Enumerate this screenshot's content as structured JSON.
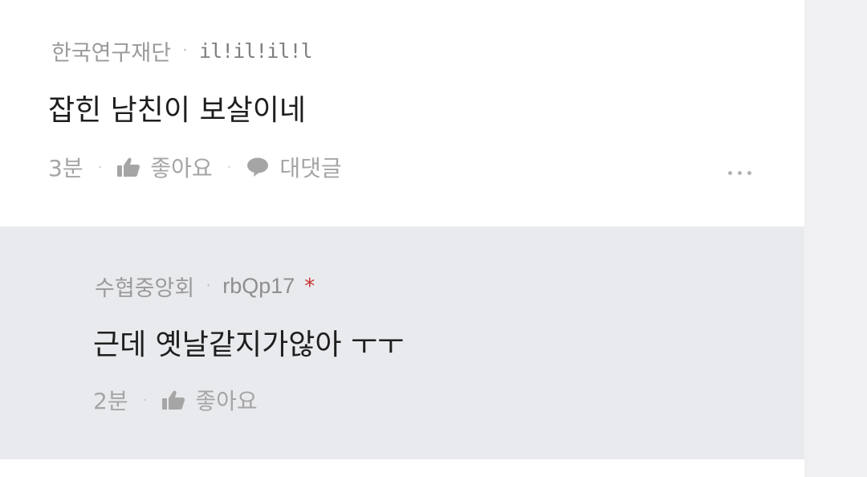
{
  "comments": [
    {
      "affiliation": "한국연구재단",
      "username": "il!il!il!l",
      "text": "잡힌 남친이 보살이네",
      "time": "3분",
      "like_label": "좋아요",
      "reply_label": "대댓글",
      "icons": [
        "thumbs-up-icon",
        "speech-bubble-icon",
        "more-dots-icon"
      ]
    },
    {
      "affiliation": "수협중앙회",
      "username": "rbQp17",
      "author_marker": "*",
      "text": "근데 옛날같지가않아 ㅜㅜ",
      "time": "2분",
      "like_label": "좋아요",
      "icons": [
        "thumbs-up-icon"
      ]
    }
  ],
  "colors": {
    "reply_background": "#e9eaee",
    "author_marker": "#c8312f",
    "muted_text": "#9a9a9a",
    "body_text": "#1e1e1e"
  }
}
